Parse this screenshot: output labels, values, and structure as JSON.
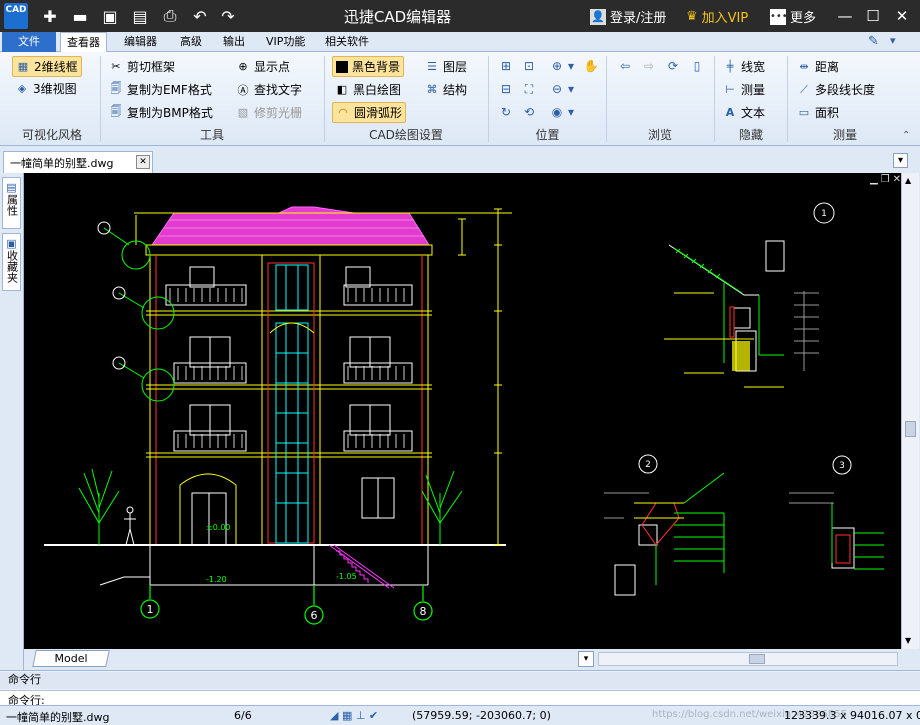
{
  "window": {
    "title": "迅捷CAD编辑器",
    "logo": "CAD",
    "login": "登录/注册",
    "vip": "加入VIP",
    "more": "更多"
  },
  "menu": [
    "文件",
    "查看器",
    "编辑器",
    "高级",
    "输出",
    "VIP功能",
    "相关软件"
  ],
  "ribbon": {
    "visual": {
      "items": [
        "2维线框",
        "3维视图"
      ],
      "group": "可视化风格"
    },
    "tools": {
      "items": [
        "剪切框架",
        "复制为EMF格式",
        "复制为BMP格式",
        "显示点",
        "查找文字",
        "修剪光栅"
      ],
      "group": "工具"
    },
    "cadset": {
      "items": [
        "黑色背景",
        "黑白绘图",
        "圆滑弧形",
        "图层",
        "结构"
      ],
      "group": "CAD绘图设置"
    },
    "position": {
      "group": "位置"
    },
    "browse": {
      "group": "浏览"
    },
    "hide": {
      "items": [
        "线宽",
        "测量",
        "文本"
      ],
      "group": "隐藏"
    },
    "measure": {
      "items": [
        "距离",
        "多段线长度",
        "面积"
      ],
      "group": "测量"
    }
  },
  "document": {
    "tab": "一幢简单的别墅.dwg"
  },
  "sidebar": {
    "tabs": [
      "属性",
      "收藏夹"
    ]
  },
  "drawing": {
    "elev_labels": [
      "-1.20",
      "-1.05",
      "±0.00"
    ],
    "axis_labels": [
      "1",
      "6",
      "8"
    ],
    "detail_labels": [
      "1",
      "2",
      "3"
    ]
  },
  "model_tab": "Model",
  "command": {
    "title": "命令行",
    "prompt": "命令行:"
  },
  "status": {
    "file": "一幢简单的别墅.dwg",
    "page": "6/6",
    "coords": "(57959.59; -203060.7; 0)",
    "watermark": "https://blog.csdn.net/weixin_42396855",
    "size": "123339.3 x 94016.07 x 0"
  },
  "colors": {
    "accent": "#2f6fcc",
    "roof": "#e33bd0",
    "wall": "#ffff00",
    "green": "#00ff00",
    "cyan": "#00ffff",
    "red": "#ff3030",
    "bg": "#000000"
  }
}
